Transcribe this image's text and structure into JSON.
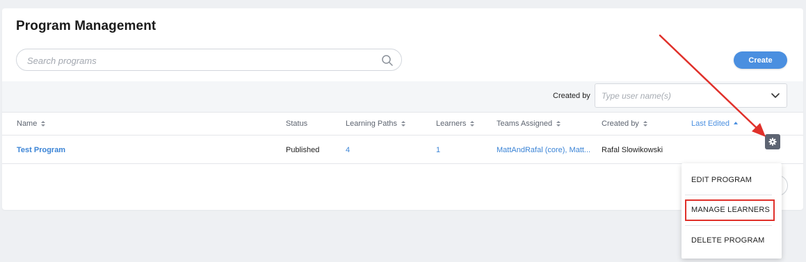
{
  "header": {
    "title": "Program Management"
  },
  "search": {
    "placeholder": "Search programs",
    "value": "",
    "icon": "search-icon"
  },
  "toolbar": {
    "create_label": "Create",
    "accent_color": "#4a8fe0"
  },
  "filters": {
    "created_by_label": "Created by",
    "created_by_placeholder": "Type user name(s)",
    "dropdown_icon": "chevron-down-icon"
  },
  "table": {
    "columns": [
      {
        "label": "Name",
        "sortable": true
      },
      {
        "label": "Status",
        "sortable": false
      },
      {
        "label": "Learning Paths",
        "sortable": true
      },
      {
        "label": "Learners",
        "sortable": true
      },
      {
        "label": "Teams Assigned",
        "sortable": true
      },
      {
        "label": "Created by",
        "sortable": true
      },
      {
        "label": "Last Edited",
        "sortable": true,
        "sorted": "ascending"
      }
    ],
    "rows": [
      {
        "name": "Test Program",
        "status": "Published",
        "learning_paths": "4",
        "learners": "1",
        "teams_assigned": "MattAndRafal (core), Matt...",
        "created_by": "Rafal Slowikowski",
        "actions_icon": "gear-icon"
      }
    ]
  },
  "action_menu": {
    "items": [
      {
        "label": "EDIT PROGRAM"
      },
      {
        "label": "MANAGE LEARNERS",
        "highlighted": true
      },
      {
        "label": "DELETE PROGRAM"
      }
    ]
  },
  "annotation": {
    "arrow_color": "#e0302a",
    "highlight_color": "#e0302a"
  }
}
